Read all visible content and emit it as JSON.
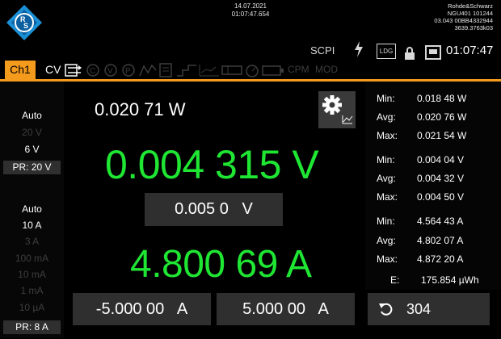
{
  "header": {
    "date": "14.07.2021",
    "time": "01:07:47.654",
    "brand": "Rohde&Schwarz",
    "model_serial": "NGU401 101244",
    "firmware": "03.043 00BB4332944",
    "version": "3639.3763k03",
    "status": {
      "scpi": "SCPI",
      "ldg": "LDG",
      "clock": "01:07:47"
    }
  },
  "channel_bar": {
    "channel": "Ch1",
    "mode": "CV",
    "cpm": "CPM",
    "mod": "MOD",
    "icons": [
      "remote-sense-icon",
      "constant-current-icon",
      "constant-voltage-icon",
      "constant-power-icon",
      "ramp-icon",
      "list-icon",
      "step-icon",
      "logging-icon",
      "meter-icon",
      "fast-log-icon",
      "battery-icon"
    ]
  },
  "voltage_range": {
    "items": [
      {
        "label": "Auto",
        "active": true
      },
      {
        "label": "20 V",
        "active": false
      },
      {
        "label": "6 V",
        "active": true
      }
    ],
    "pr": "PR: 20 V"
  },
  "current_range": {
    "items": [
      {
        "label": "Auto",
        "active": true
      },
      {
        "label": "10 A",
        "active": true
      },
      {
        "label": "3 A",
        "active": false
      },
      {
        "label": "100 mA",
        "active": false
      },
      {
        "label": "10 mA",
        "active": false
      },
      {
        "label": "1 mA",
        "active": false
      },
      {
        "label": "10 µA",
        "active": false
      }
    ],
    "pr": "PR: 8 A"
  },
  "main": {
    "power": "0.020 71 W",
    "voltage": "0.004 315 V",
    "voltage_setpoint": "0.005 0   V",
    "current": "4.800 69 A",
    "current_neg_limit": "-5.000 00   A",
    "current_pos_limit": "5.000 00   A"
  },
  "stats": {
    "power": [
      {
        "label": "Min:",
        "value": "0.018 48 W"
      },
      {
        "label": "Avg:",
        "value": "0.020 76 W"
      },
      {
        "label": "Max:",
        "value": "0.021 54 W"
      }
    ],
    "voltage": [
      {
        "label": "Min:",
        "value": "0.004 04 V"
      },
      {
        "label": "Avg:",
        "value": "0.004 32 V"
      },
      {
        "label": "Max:",
        "value": "0.004 50 V"
      }
    ],
    "current": [
      {
        "label": "Min:",
        "value": "4.564 43 A"
      },
      {
        "label": "Avg:",
        "value": "4.802 07 A"
      },
      {
        "label": "Max:",
        "value": "4.872 20 A"
      }
    ],
    "energy": {
      "label": "E:",
      "value": "175.854 µWh"
    }
  },
  "undo": {
    "count": "304"
  },
  "colors": {
    "accent": "#f49a1c",
    "reading": "#1fe633",
    "button": "#2f2f2f",
    "dim": "#3d3d3d"
  }
}
